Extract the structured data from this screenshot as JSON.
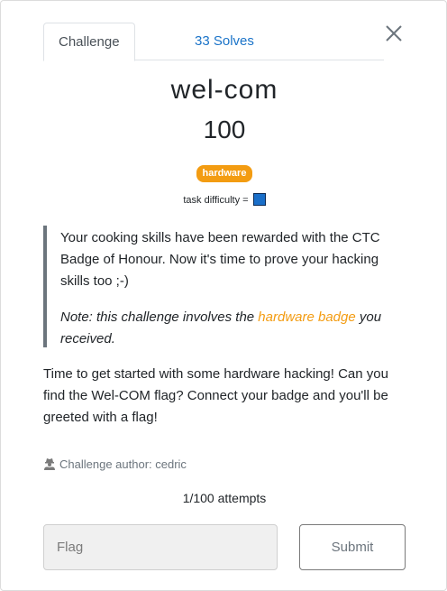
{
  "tabs": {
    "challenge_label": "Challenge",
    "solves_label": "33 Solves"
  },
  "challenge": {
    "name": "wel-com",
    "points": "100",
    "tag": "hardware",
    "difficulty_label": "task difficulty = ",
    "difficulty_color": "#1a6fc9"
  },
  "description": {
    "quote_text": "Your cooking skills have been rewarded with the CTC Badge of Honour. Now it's time to prove your hacking skills too ;-)",
    "note_prefix": "Note: this challenge involves the ",
    "note_link": "hardware badge",
    "note_suffix": " you received.",
    "body": "Time to get started with some hardware hacking! Can you find the Wel-COM flag? Connect your badge and you'll be greeted with a flag!"
  },
  "author": {
    "label": "Challenge author: cedric",
    "icon": "user-secret-icon"
  },
  "attempts": "1/100 attempts",
  "form": {
    "flag_placeholder": "Flag",
    "submit_label": "Submit"
  },
  "colors": {
    "accent_orange": "#f39c12",
    "link_blue": "#1a73c8"
  }
}
